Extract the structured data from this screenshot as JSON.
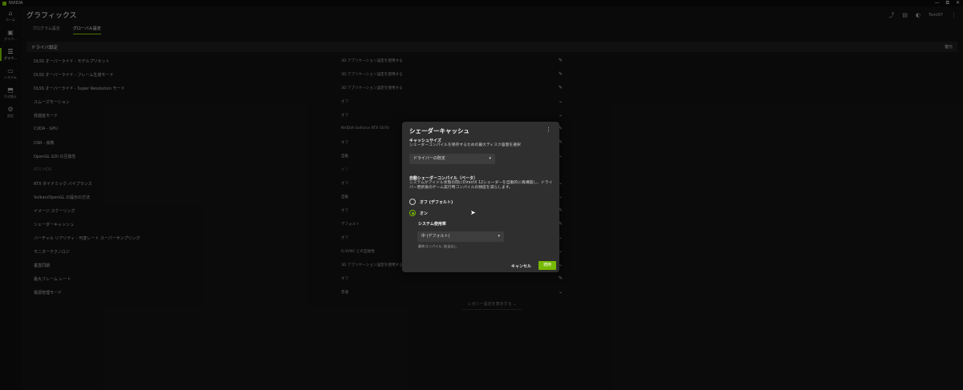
{
  "window": {
    "app_name": "NVIDIA",
    "controls": [
      "—",
      "⧉",
      "✕"
    ]
  },
  "rail": {
    "items": [
      {
        "icon": "⌂",
        "label": "ホーム",
        "icon_name": "home-icon"
      },
      {
        "icon": "▣",
        "label": "グラフ…",
        "icon_name": "graphics-app-icon"
      },
      {
        "icon": "☰",
        "label": "グラフ…",
        "icon_name": "graphics-settings-icon",
        "active": true
      },
      {
        "icon": "▭",
        "label": "システム",
        "icon_name": "system-icon"
      },
      {
        "icon": "⬒",
        "label": "引き換え",
        "icon_name": "redeem-icon"
      },
      {
        "icon": "⚙",
        "label": "設定",
        "icon_name": "settings-icon"
      }
    ]
  },
  "header": {
    "title": "グラフィックス",
    "user_name": "Tomi97",
    "icons": [
      "share-icon",
      "feedback-icon",
      "avatar-icon"
    ]
  },
  "tabs": [
    {
      "label": "プログラム設定",
      "active": false
    },
    {
      "label": "グローバル設定",
      "active": true
    }
  ],
  "section": {
    "title": "ドライバ設定",
    "restore_label": "復元"
  },
  "settings": [
    {
      "label": "DLSS オーバーライド - モデルプリセット",
      "value": "3D アプリケーション設定を使用する",
      "control": "✎"
    },
    {
      "label": "DLSS オーバーライド - フレーム生成モード",
      "value": "3D アプリケーション設定を使用する",
      "control": "✎"
    },
    {
      "label": "DLSS オーバーライド - Super Resolution モード",
      "value": "3D アプリケーション設定を使用する",
      "control": "✎"
    },
    {
      "label": "スムーズモーション",
      "value": "オフ",
      "control": "⌄"
    },
    {
      "label": "低遅延モード",
      "value": "オフ",
      "control": "⌄"
    },
    {
      "label": "CUDA - GPU",
      "value": "NVIDIA GeForce RTX 5070",
      "control": "✎"
    },
    {
      "label": "DSR - 係数",
      "value": "オフ",
      "control": "✎"
    },
    {
      "label": "OpenGL GDI の互換性",
      "value": "自動",
      "control": "⌄"
    },
    {
      "label": "RTX HDR",
      "value": "オフ",
      "control": "",
      "dim": true
    },
    {
      "label": "RTX ダイナミック バイブランス",
      "value": "オフ",
      "control": "⌄"
    },
    {
      "label": "Vulkan/OpenGL の提示の方法",
      "value": "自動",
      "control": "⌄"
    },
    {
      "label": "イメージ スケーリング",
      "value": "オフ",
      "control": "✎"
    },
    {
      "label": "シェーダーキャッシュ",
      "value": "デフォルト",
      "control": "✎"
    },
    {
      "label": "バーチャル リアリティ - 可変レート スーパーサンプリング",
      "value": "オフ",
      "control": "⌄"
    },
    {
      "label": "モニターテクノロジ",
      "value": "G-SYNC との互換性",
      "control": "⌄"
    },
    {
      "label": "垂直同期",
      "value": "3D アプリケーション設定を使用する",
      "control": "⌄"
    },
    {
      "label": "最大フレーム レート",
      "value": "オフ",
      "control": "✎"
    },
    {
      "label": "電源管理モード",
      "value": "普通",
      "control": "⌄"
    }
  ],
  "legacy_link": "レガシー設定を表示する ⌄",
  "dialog": {
    "title": "シェーダーキャッシュ",
    "more": "⋮",
    "cache_size": {
      "heading": "キャッシュサイズ",
      "description": "シェーダーコンパイルを保存するための最大ディスク容量を選択",
      "selected": "ドライバーの既定"
    },
    "auto_compile": {
      "heading": "自動シェーダーコンパイル（ベータ）",
      "description": "システムがアイドル状態の間にDirectX 12シェーダーを自動的に再構築し、ドライバー更新後のゲーム実行時コンパイルの頻度を減らします。",
      "options": [
        {
          "label": "オフ (デフォルト)",
          "selected": false
        },
        {
          "label": "オン",
          "selected": true
        }
      ],
      "usage_label": "システム使用率",
      "usage_selected": "中 (デフォルト)",
      "last_compile": "最終コンパイル: 該当なし"
    },
    "cancel_label": "キャンセル",
    "apply_label": "適用"
  },
  "colors": {
    "accent": "#76b900",
    "background": "#111112",
    "dialog": "#2f2f30"
  }
}
